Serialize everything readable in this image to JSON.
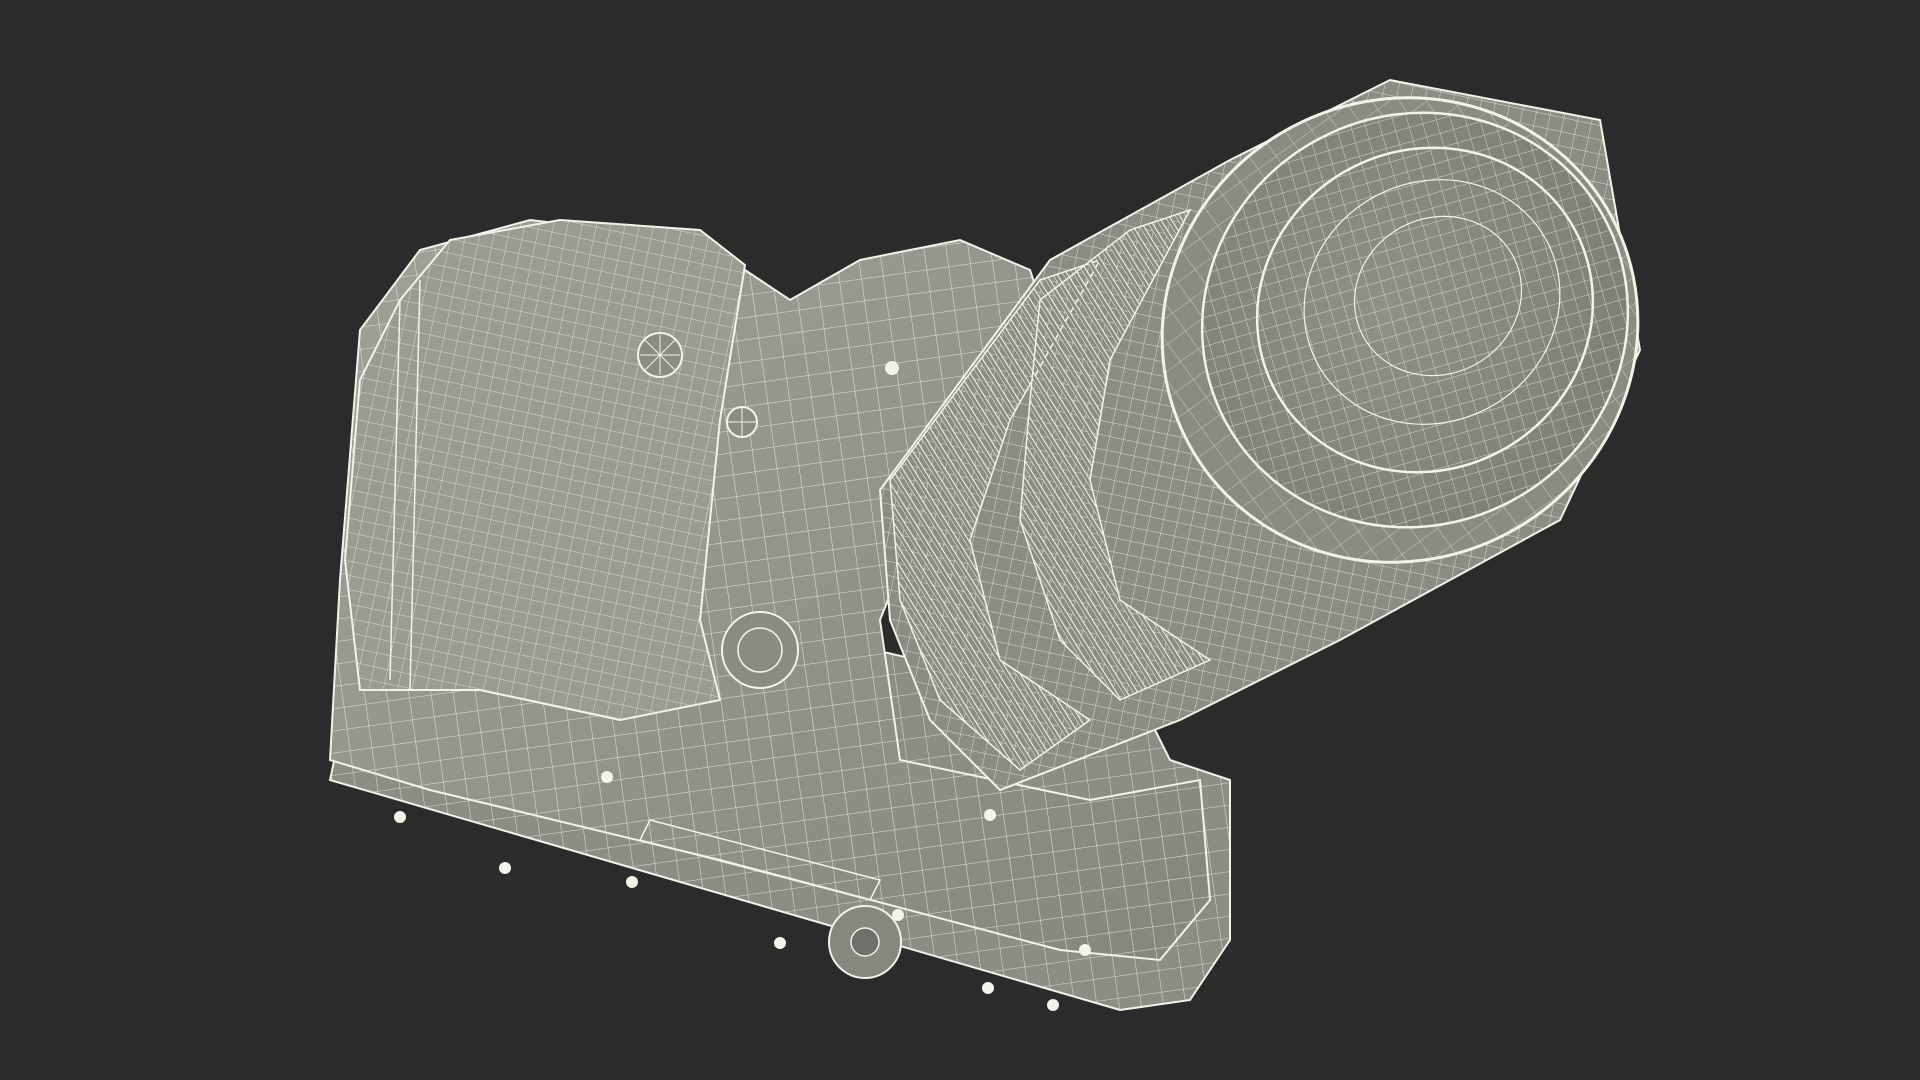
{
  "scene": {
    "subject": "camera-wireframe-render",
    "colors": {
      "background": "#2b2b2b",
      "surface": "#8e8f86",
      "surface_light": "#a3a49b",
      "surface_dark": "#74756d",
      "wire": "#f2f2e8"
    }
  }
}
